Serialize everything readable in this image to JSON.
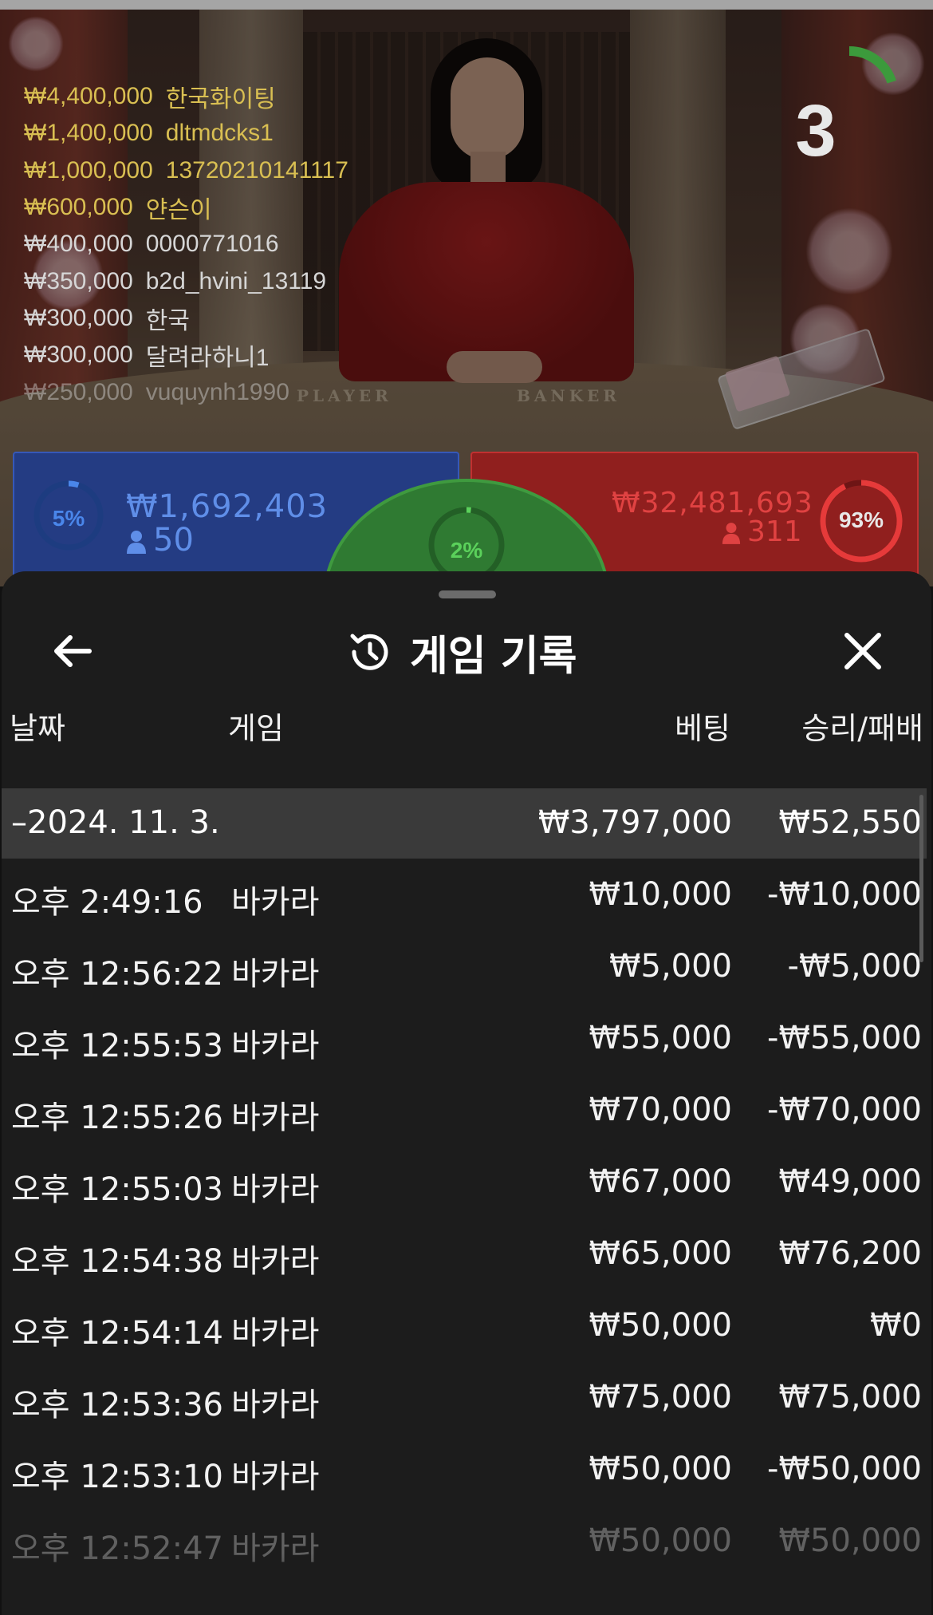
{
  "live_video": {
    "table_labels": {
      "player": "PLAYER",
      "banker": "BANKER"
    },
    "countdown": {
      "value": "3",
      "progress": 0.2
    },
    "winners": [
      {
        "amount": "₩4,400,000",
        "name": "한국화이팅",
        "style": "gold"
      },
      {
        "amount": "₩1,400,000",
        "name": "dltmdcks1",
        "style": "gold"
      },
      {
        "amount": "₩1,000,000",
        "name": "13720210141117",
        "style": "gold"
      },
      {
        "amount": "₩600,000",
        "name": "얀슨이",
        "style": "gold"
      },
      {
        "amount": "₩400,000",
        "name": "0000771016",
        "style": "white"
      },
      {
        "amount": "₩350,000",
        "name": "b2d_hvini_13119",
        "style": "white"
      },
      {
        "amount": "₩300,000",
        "name": "한국",
        "style": "white"
      },
      {
        "amount": "₩300,000",
        "name": "달려라하니1",
        "style": "white"
      },
      {
        "amount": "₩250,000",
        "name": "vuquynh1990",
        "style": "fade"
      }
    ],
    "bets": {
      "player": {
        "percent": "5%",
        "percent_value": 5,
        "amount": "₩1,692,403",
        "players": "50",
        "color": "#2f6fe0"
      },
      "tie": {
        "percent": "2%",
        "percent_value": 2,
        "color": "#4caf50"
      },
      "banker": {
        "percent": "93%",
        "percent_value": 93,
        "amount": "₩32,481,693",
        "players": "311",
        "color": "#e03a3a"
      }
    }
  },
  "sheet": {
    "title": "게임 기록",
    "title_icon": "history-icon",
    "back_icon": "arrow-left-icon",
    "close_icon": "close-icon",
    "columns": {
      "date": "날짜",
      "game": "게임",
      "bet": "베팅",
      "win_loss": "승리/패배"
    },
    "summary": {
      "date": "–2024. 11. 3.",
      "bet": "₩3,797,000",
      "win_loss": "₩52,550"
    },
    "rows": [
      {
        "time": "오후 2:49:16",
        "game": "바카라",
        "bet": "₩10,000",
        "win_loss": "-₩10,000"
      },
      {
        "time": "오후 12:56:22",
        "game": "바카라",
        "bet": "₩5,000",
        "win_loss": "-₩5,000"
      },
      {
        "time": "오후 12:55:53",
        "game": "바카라",
        "bet": "₩55,000",
        "win_loss": "-₩55,000"
      },
      {
        "time": "오후 12:55:26",
        "game": "바카라",
        "bet": "₩70,000",
        "win_loss": "-₩70,000"
      },
      {
        "time": "오후 12:55:03",
        "game": "바카라",
        "bet": "₩67,000",
        "win_loss": "₩49,000"
      },
      {
        "time": "오후 12:54:38",
        "game": "바카라",
        "bet": "₩65,000",
        "win_loss": "₩76,200"
      },
      {
        "time": "오후 12:54:14",
        "game": "바카라",
        "bet": "₩50,000",
        "win_loss": "₩0"
      },
      {
        "time": "오후 12:53:36",
        "game": "바카라",
        "bet": "₩75,000",
        "win_loss": "₩75,000"
      },
      {
        "time": "오후 12:53:10",
        "game": "바카라",
        "bet": "₩50,000",
        "win_loss": "-₩50,000"
      },
      {
        "time": "오후 12:52:47",
        "game": "바카라",
        "bet": "₩50,000",
        "win_loss": "₩50,000"
      }
    ]
  }
}
